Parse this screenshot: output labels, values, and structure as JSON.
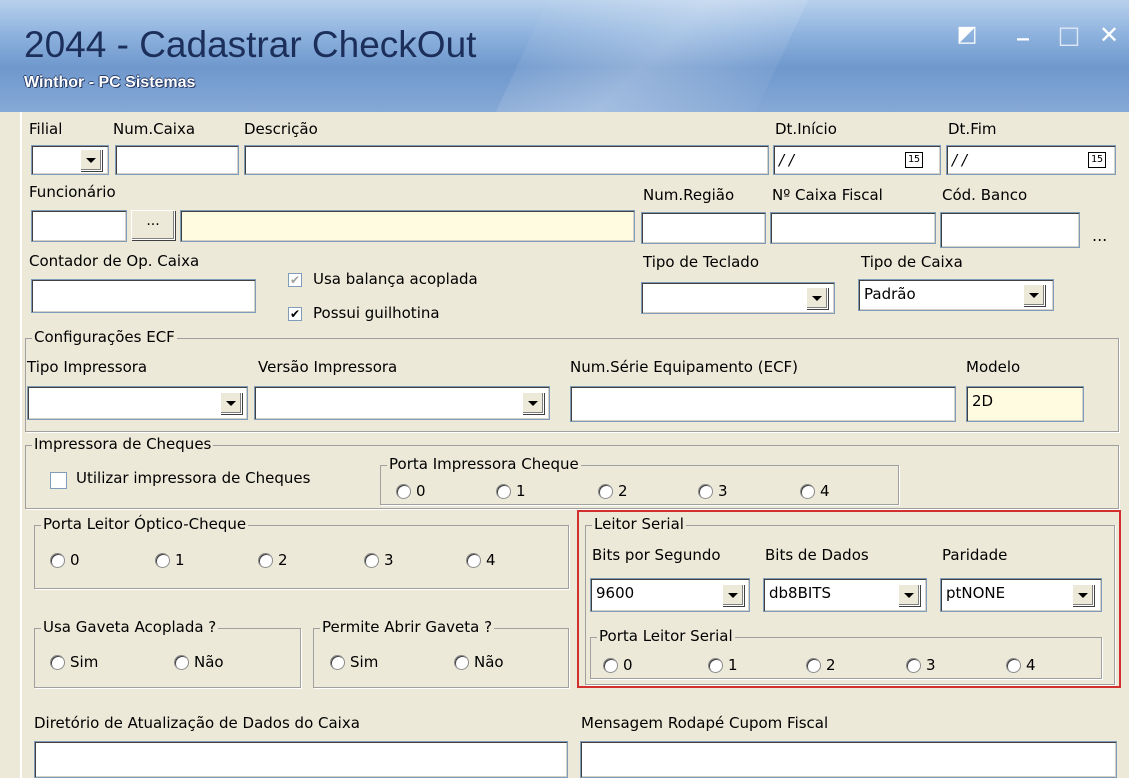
{
  "window": {
    "title": "2044 - Cadastrar CheckOut",
    "subtitle": "Winthor - PC Sistemas",
    "controls": {
      "restore": "◩",
      "minimize": "_",
      "maximize": "□",
      "close": "✕"
    }
  },
  "row1": {
    "filial_label": "Filial",
    "num_caixa_label": "Num.Caixa",
    "descricao_label": "Descrição",
    "dt_inicio_label": "Dt.Início",
    "dt_inicio_value": "/ /",
    "dt_fim_label": "Dt.Fim",
    "dt_fim_value": "/ /",
    "calendar_label": "15"
  },
  "row2": {
    "funcionario_label": "Funcionário",
    "ellipsis": "...",
    "num_regiao_label": "Num.Região",
    "caixa_fiscal_label": "Nº Caixa Fiscal",
    "cod_banco_label": "Cód. Banco"
  },
  "row3": {
    "contador_label": "Contador de Op. Caixa",
    "usa_balanca_label": "Usa balança acoplada",
    "possui_guilhotina_label": "Possui guilhotina",
    "tipo_teclado_label": "Tipo de Teclado",
    "tipo_caixa_label": "Tipo de Caixa",
    "tipo_caixa_value": "Padrão"
  },
  "ecf": {
    "group_title": "Configurações ECF",
    "tipo_impressora_label": "Tipo Impressora",
    "versao_impressora_label": "Versão Impressora",
    "num_serie_label": "Num.Série Equipamento (ECF)",
    "modelo_label": "Modelo",
    "modelo_value": "2D"
  },
  "cheques": {
    "group_title": "Impressora de Cheques",
    "utilizar_label": "Utilizar impressora de Cheques",
    "porta_title": "Porta Impressora Cheque",
    "options": [
      "0",
      "1",
      "2",
      "3",
      "4"
    ]
  },
  "leitor_optico": {
    "group_title": "Porta Leitor Óptico-Cheque",
    "options": [
      "0",
      "1",
      "2",
      "3",
      "4"
    ]
  },
  "gaveta": {
    "usa_title": "Usa Gaveta Acoplada ?",
    "permite_title": "Permite Abrir Gaveta ?",
    "sim": "Sim",
    "nao": "Não"
  },
  "leitor_serial": {
    "group_title": "Leitor Serial",
    "bits_segundo_label": "Bits por Segundo",
    "bits_segundo_value": "9600",
    "bits_dados_label": "Bits de Dados",
    "bits_dados_value": "db8BITS",
    "paridade_label": "Paridade",
    "paridade_value": "ptNONE",
    "porta_title": "Porta Leitor Serial",
    "options": [
      "0",
      "1",
      "2",
      "3",
      "4"
    ]
  },
  "bottom": {
    "diretorio_label": "Diretório de Atualização de Dados do Caixa",
    "mensagem_label": "Mensagem Rodapé Cupom Fiscal"
  },
  "colors": {
    "highlight": "#d32f2f",
    "readonly_field": "#fffbe0"
  }
}
